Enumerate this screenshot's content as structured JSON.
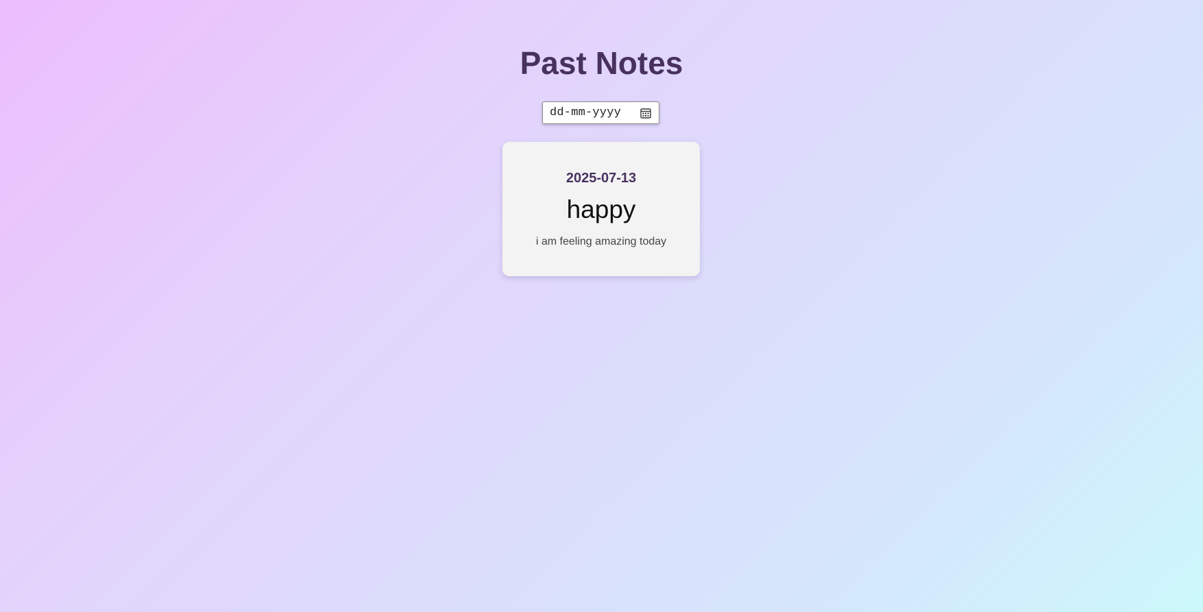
{
  "page": {
    "title": "Past Notes"
  },
  "filter": {
    "date_placeholder": "dd-mm-yyyy",
    "icon": "calendar-icon"
  },
  "notes": [
    {
      "date": "2025-07-13",
      "mood": "happy",
      "text": "i am feeling amazing today"
    }
  ],
  "colors": {
    "title": "#48315f",
    "card_background": "#f3f3f4",
    "gradient_start": "#ecbdfd",
    "gradient_end": "#ccf8fb"
  }
}
